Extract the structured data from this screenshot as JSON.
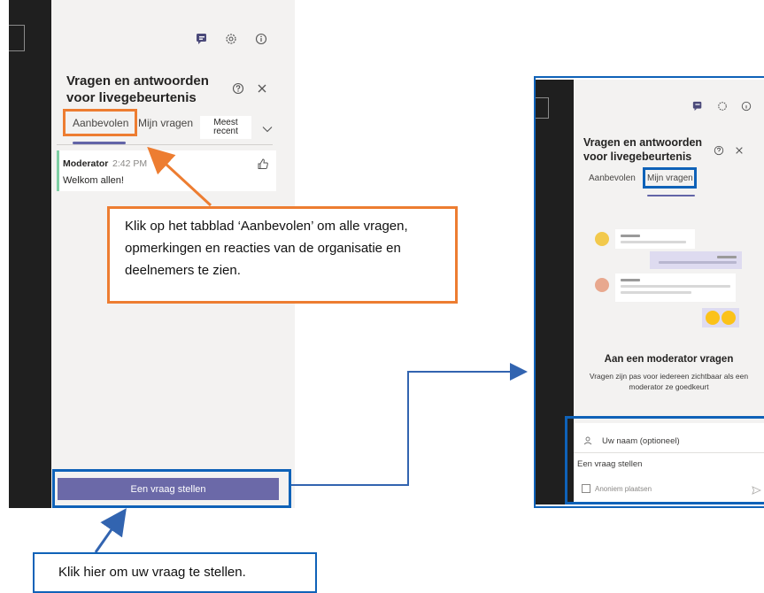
{
  "left_panel": {
    "title_line1": "Vragen en antwoorden",
    "title_line2": "voor livegebeurtenis",
    "tabs": [
      {
        "label": "Aanbevolen"
      },
      {
        "label": "Mijn vragen"
      }
    ],
    "sort": {
      "line1": "Meest",
      "line2": "recent"
    },
    "message": {
      "author": "Moderator",
      "time": "2:42 PM",
      "text": "Welkom allen!"
    },
    "ask_button": "Een vraag stellen"
  },
  "callouts": {
    "tab_hint": "Klik op het tabblad ‘Aanbevolen’ om alle vragen, opmerkingen en reacties van de organisatie en deelnemers te zien.",
    "ask_hint": "Klik hier om uw vraag te stellen."
  },
  "right_panel": {
    "title_line1": "Vragen en antwoorden",
    "title_line2": "voor livegebeurtenis",
    "tabs": [
      {
        "label": "Aanbevolen"
      },
      {
        "label": "Mijn vragen"
      }
    ],
    "empty_title": "Aan een moderator vragen",
    "empty_text_line1": "Vragen zijn pas voor iedereen zichtbaar als een",
    "empty_text_line2": "moderator ze goedkeurt",
    "name_placeholder": "Uw naam (optioneel)",
    "question_placeholder": "Een vraag stellen",
    "anonymous_label": "Anoniem plaatsen"
  },
  "colors": {
    "accent": "#6264a7",
    "highlight_orange": "#ed7d31",
    "highlight_blue": "#0f62b8",
    "moderator_bar": "#7fcfa4"
  },
  "icons": [
    "qna-icon",
    "settings-icon",
    "info-icon",
    "help-icon",
    "close-icon",
    "chevron-down-icon",
    "thumbs-up-icon",
    "person-icon",
    "send-icon"
  ]
}
